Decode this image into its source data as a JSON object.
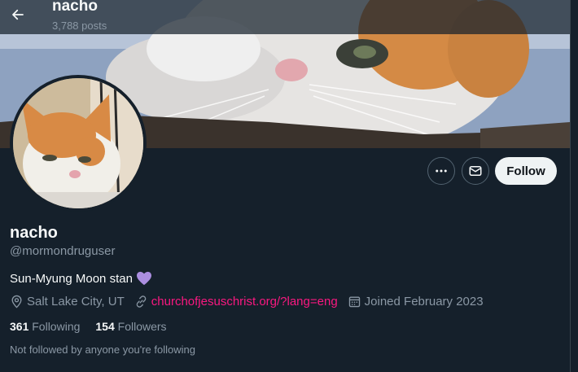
{
  "header": {
    "name": "nacho",
    "posts_count": "3,788 posts"
  },
  "icons": {
    "back": "arrow-left-icon",
    "more": "more-horizontal-icon",
    "message": "envelope-icon",
    "location": "map-pin-icon",
    "link": "link-icon",
    "calendar": "calendar-icon",
    "heart": "purple-heart-icon"
  },
  "profile": {
    "display_name": "nacho",
    "handle": "@mormondruguser",
    "bio": "Sun-Myung Moon stan",
    "location": "Salt Lake City, UT",
    "website": "churchofjesuschrist.org/?lang=eng",
    "joined": "Joined February 2023"
  },
  "actions": {
    "follow_label": "Follow"
  },
  "stats": {
    "following_count": "361",
    "following_label": "Following",
    "followers_count": "154",
    "followers_label": "Followers"
  },
  "social_context": "Not followed by anyone you're following",
  "colors": {
    "background": "#15202b",
    "link": "#f91880",
    "muted_text": "#8b98a5",
    "heart": "#ab8ee0",
    "follow_button": "#eff3f4"
  }
}
